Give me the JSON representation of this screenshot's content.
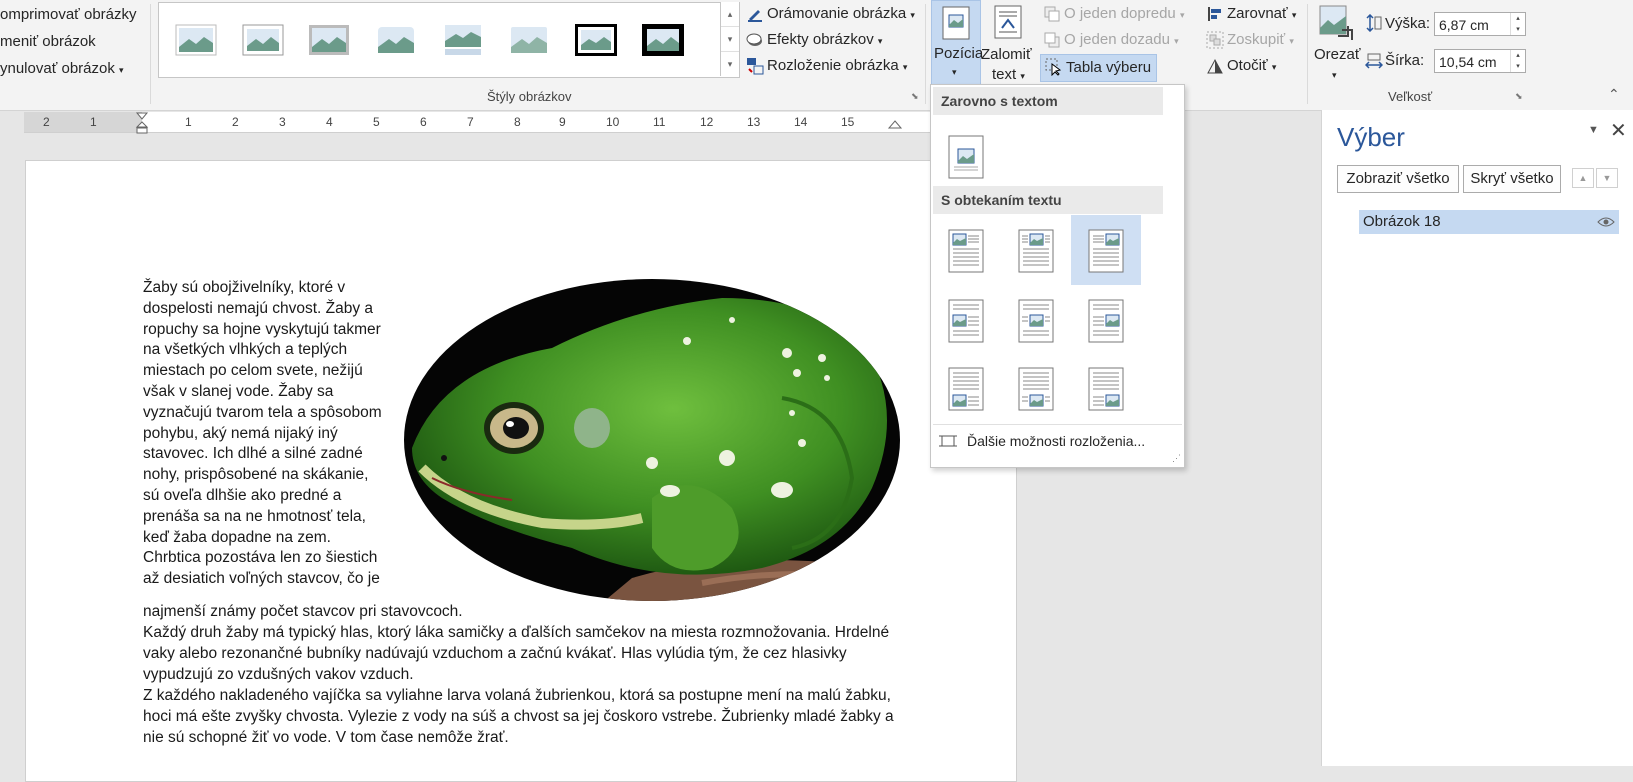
{
  "ribbon": {
    "adjust": [
      "omprimovať obrázky",
      "meniť obrázok",
      "ynulovať obrázok"
    ],
    "styles_group_label": "Štýly obrázkov",
    "border_label": "Orámovanie obrázka",
    "effects_label": "Efekty obrázkov",
    "layout_label": "Rozloženie obrázka",
    "position_label": "Pozícia",
    "wrap_label_1": "Zalomiť",
    "wrap_label_2": "text",
    "forward_label": "O jeden dopredu",
    "backward_label": "O jeden dozadu",
    "selection_pane_label": "Tabla výberu",
    "align_label": "Zarovnať",
    "group_label": "Zoskupiť",
    "rotate_label": "Otočiť",
    "crop_label": "Orezať",
    "height_label": "Výška:",
    "height_value": "6,87 cm",
    "width_label": "Šírka:",
    "width_value": "10,54 cm",
    "size_group_label": "Veľkosť"
  },
  "ruler": {
    "numbers": [
      "2",
      "1",
      "1",
      "2",
      "3",
      "4",
      "5",
      "6",
      "7",
      "8",
      "9",
      "10",
      "11",
      "12",
      "13",
      "14",
      "15"
    ]
  },
  "document": {
    "wrap_paragraph": "Žaby sú obojživelníky, ktoré v dospelosti nemajú chvost. Žaby a ropuchy sa hojne vyskytujú takmer na všetkých vlhkých a teplých miestach po celom svete, nežijú však v slanej vode. Žaby sa vyznačujú tvarom tela a spôsobom pohybu, aký nemá nijaký iný stavovec. Ich dlhé a silné zadné nohy, prispôsobené na skákanie, sú oveľa dlhšie ako predné a prenáša sa na ne hmotnosť tela, keď žaba dopadne na zem. Chrbtica pozostáva len zo šiestich až desiatich voľných stavcov, čo je",
    "wrap_tail": "najmenší známy počet stavcov pri stavovcoch.",
    "para2": "Každý druh žaby má typický hlas, ktorý láka samičky a ďalších samčekov na miesta rozmnožovania. Hrdelné vaky alebo rezonančné bubníky nadúvajú vzduchom a začnú kvákať. Hlas vylúdia tým, že cez hlasivky vypudzujú zo vzdušných vakov vzduch.",
    "para3": "Z každého nakladeného vajíčka sa vyliahne larva volaná žubrienkou, ktorá sa postupne mení na malú žabku, hoci má ešte zvyšky chvosta. Vylezie z vody na súš a chvost sa jej čoskoro vstrebe. Žubrienky mladé žabky a nie sú schopné žiť vo vode. V tom čase nemôže žrať."
  },
  "position_menu": {
    "inline_header": "Zarovno s textom",
    "wrap_header": "S obtekaním textu",
    "more_options": "Ďalšie možnosti rozloženia..."
  },
  "selection_pane": {
    "title": "Výber",
    "show_all": "Zobraziť všetko",
    "hide_all": "Skryť všetko",
    "item": "Obrázok 18"
  }
}
